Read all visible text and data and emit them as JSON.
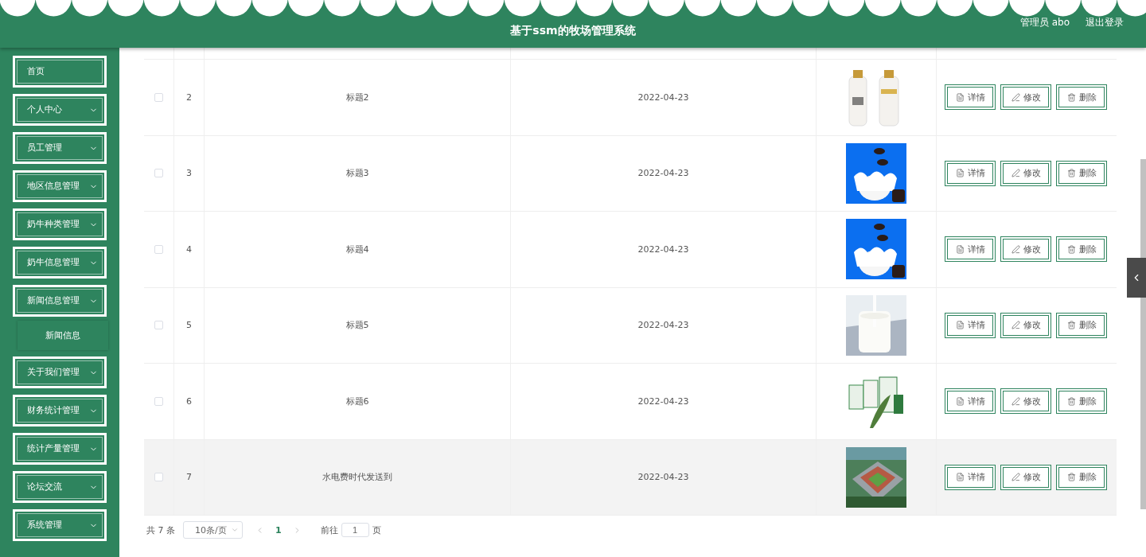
{
  "header": {
    "title": "基于ssm的牧场管理系统",
    "user": "管理员 abo",
    "logout": "退出登录"
  },
  "sidebar": {
    "items": [
      {
        "label": "首页",
        "expandable": false
      },
      {
        "label": "个人中心",
        "expandable": true
      },
      {
        "label": "员工管理",
        "expandable": true
      },
      {
        "label": "地区信息管理",
        "expandable": true
      },
      {
        "label": "奶牛种类管理",
        "expandable": true
      },
      {
        "label": "奶牛信息管理",
        "expandable": true
      },
      {
        "label": "新闻信息管理",
        "expandable": true,
        "children": [
          {
            "label": "新闻信息"
          }
        ]
      },
      {
        "label": "关于我们管理",
        "expandable": true
      },
      {
        "label": "财务统计管理",
        "expandable": true
      },
      {
        "label": "统计产量管理",
        "expandable": true
      },
      {
        "label": "论坛交流",
        "expandable": true
      },
      {
        "label": "系统管理",
        "expandable": true
      }
    ]
  },
  "table": {
    "rows": [
      {
        "checked": false,
        "index": "2",
        "title": "标题2",
        "date": "2022-04-23",
        "hovered": false,
        "actions": [
          {
            "kind": "detail",
            "label": "详情"
          },
          {
            "kind": "edit",
            "label": "修改"
          },
          {
            "kind": "delete",
            "label": "删除"
          }
        ]
      },
      {
        "checked": false,
        "index": "3",
        "title": "标题3",
        "date": "2022-04-23",
        "hovered": false,
        "actions": [
          {
            "kind": "detail",
            "label": "详情"
          },
          {
            "kind": "edit",
            "label": "修改"
          },
          {
            "kind": "delete",
            "label": "删除"
          }
        ]
      },
      {
        "checked": false,
        "index": "4",
        "title": "标题4",
        "date": "2022-04-23",
        "hovered": false,
        "actions": [
          {
            "kind": "detail",
            "label": "详情"
          },
          {
            "kind": "edit",
            "label": "修改"
          },
          {
            "kind": "delete",
            "label": "删除"
          }
        ]
      },
      {
        "checked": false,
        "index": "5",
        "title": "标题5",
        "date": "2022-04-23",
        "hovered": false,
        "actions": [
          {
            "kind": "detail",
            "label": "详情"
          },
          {
            "kind": "edit",
            "label": "修改"
          },
          {
            "kind": "delete",
            "label": "删除"
          }
        ]
      },
      {
        "checked": false,
        "index": "6",
        "title": "标题6",
        "date": "2022-04-23",
        "hovered": false,
        "actions": [
          {
            "kind": "detail",
            "label": "详情"
          },
          {
            "kind": "edit",
            "label": "修改"
          },
          {
            "kind": "delete",
            "label": "删除"
          }
        ]
      },
      {
        "checked": false,
        "index": "7",
        "title": "水电费时代发送到",
        "date": "2022-04-23",
        "hovered": true,
        "actions": [
          {
            "kind": "detail",
            "label": "详情"
          },
          {
            "kind": "edit",
            "label": "修改"
          },
          {
            "kind": "delete",
            "label": "删除"
          }
        ]
      }
    ]
  },
  "pagination": {
    "total": "共 7 条",
    "page_size": "10条/页",
    "pages": [
      {
        "label": "1",
        "selected": true
      }
    ],
    "goto_label": "前往",
    "goto_value": "1",
    "goto_suffix": "页"
  }
}
